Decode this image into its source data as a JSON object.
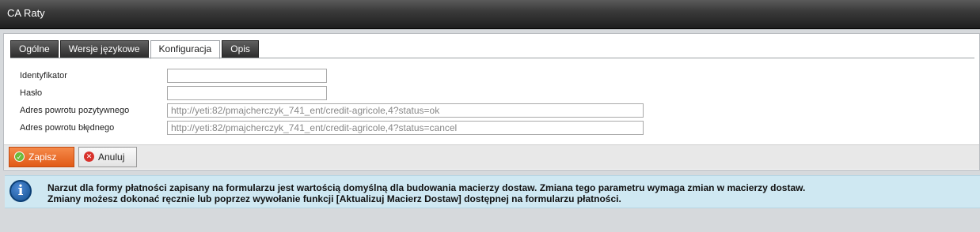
{
  "window": {
    "title": "CA Raty"
  },
  "tabs": [
    {
      "label": "Ogólne",
      "active": false
    },
    {
      "label": "Wersje językowe",
      "active": false
    },
    {
      "label": "Konfiguracja",
      "active": true
    },
    {
      "label": "Opis",
      "active": false
    }
  ],
  "form": {
    "fields": [
      {
        "label": "Identyfikator",
        "value": ""
      },
      {
        "label": "Hasło",
        "value": ""
      },
      {
        "label": "Adres powrotu pozytywnego",
        "value": "http://yeti:82/pmajcherczyk_741_ent/credit-agricole,4?status=ok"
      },
      {
        "label": "Adres powrotu błędnego",
        "value": "http://yeti:82/pmajcherczyk_741_ent/credit-agricole,4?status=cancel"
      }
    ]
  },
  "buttons": {
    "save": "Zapisz",
    "cancel": "Anuluj"
  },
  "icons": {
    "save": "check-circle-icon",
    "cancel": "close-circle-icon",
    "info": "info-icon"
  },
  "info": {
    "line1": "Narzut dla formy płatności zapisany na formularzu jest wartością domyślną dla budowania macierzy dostaw. Zmiana tego parametru wymaga zmian w macierzy dostaw.",
    "line2": "Zmiany możesz dokonać ręcznie lub poprzez wywołanie funkcji [Aktualizuj Macierz Dostaw] dostępnej na formularzu płatności."
  },
  "colors": {
    "save_button": "#e8672a",
    "info_background": "#cfe8f2",
    "titlebar": "#2e2e2e"
  }
}
